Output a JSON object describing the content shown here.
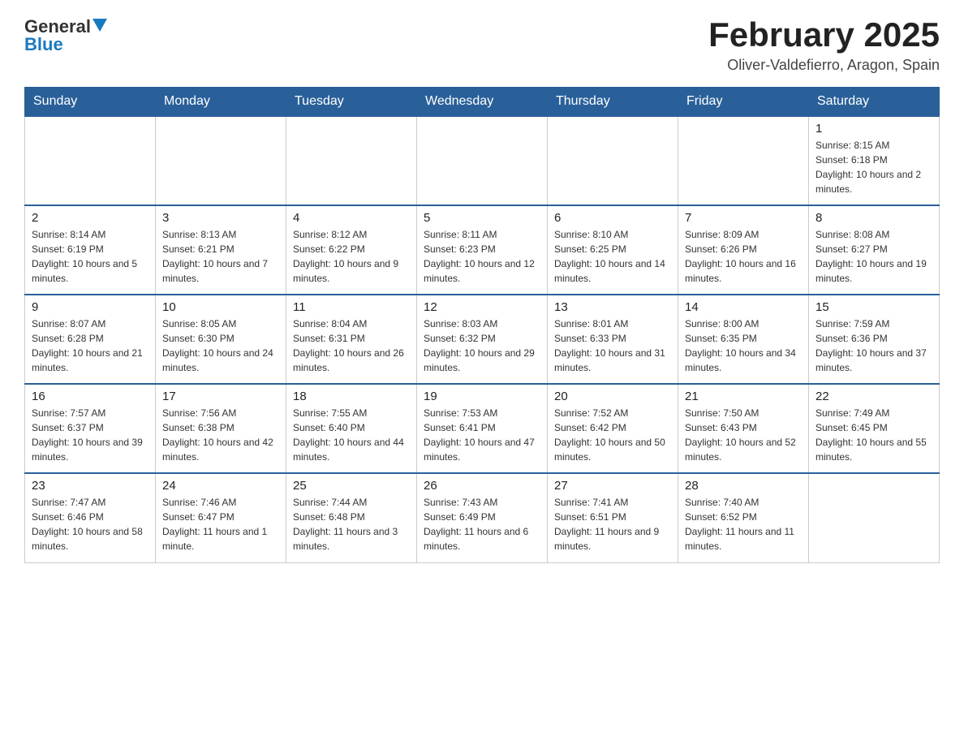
{
  "header": {
    "logo_general": "General",
    "logo_blue": "Blue",
    "month_year": "February 2025",
    "location": "Oliver-Valdefierro, Aragon, Spain"
  },
  "weekdays": [
    "Sunday",
    "Monday",
    "Tuesday",
    "Wednesday",
    "Thursday",
    "Friday",
    "Saturday"
  ],
  "weeks": [
    [
      {
        "day": "",
        "info": ""
      },
      {
        "day": "",
        "info": ""
      },
      {
        "day": "",
        "info": ""
      },
      {
        "day": "",
        "info": ""
      },
      {
        "day": "",
        "info": ""
      },
      {
        "day": "",
        "info": ""
      },
      {
        "day": "1",
        "info": "Sunrise: 8:15 AM\nSunset: 6:18 PM\nDaylight: 10 hours and 2 minutes."
      }
    ],
    [
      {
        "day": "2",
        "info": "Sunrise: 8:14 AM\nSunset: 6:19 PM\nDaylight: 10 hours and 5 minutes."
      },
      {
        "day": "3",
        "info": "Sunrise: 8:13 AM\nSunset: 6:21 PM\nDaylight: 10 hours and 7 minutes."
      },
      {
        "day": "4",
        "info": "Sunrise: 8:12 AM\nSunset: 6:22 PM\nDaylight: 10 hours and 9 minutes."
      },
      {
        "day": "5",
        "info": "Sunrise: 8:11 AM\nSunset: 6:23 PM\nDaylight: 10 hours and 12 minutes."
      },
      {
        "day": "6",
        "info": "Sunrise: 8:10 AM\nSunset: 6:25 PM\nDaylight: 10 hours and 14 minutes."
      },
      {
        "day": "7",
        "info": "Sunrise: 8:09 AM\nSunset: 6:26 PM\nDaylight: 10 hours and 16 minutes."
      },
      {
        "day": "8",
        "info": "Sunrise: 8:08 AM\nSunset: 6:27 PM\nDaylight: 10 hours and 19 minutes."
      }
    ],
    [
      {
        "day": "9",
        "info": "Sunrise: 8:07 AM\nSunset: 6:28 PM\nDaylight: 10 hours and 21 minutes."
      },
      {
        "day": "10",
        "info": "Sunrise: 8:05 AM\nSunset: 6:30 PM\nDaylight: 10 hours and 24 minutes."
      },
      {
        "day": "11",
        "info": "Sunrise: 8:04 AM\nSunset: 6:31 PM\nDaylight: 10 hours and 26 minutes."
      },
      {
        "day": "12",
        "info": "Sunrise: 8:03 AM\nSunset: 6:32 PM\nDaylight: 10 hours and 29 minutes."
      },
      {
        "day": "13",
        "info": "Sunrise: 8:01 AM\nSunset: 6:33 PM\nDaylight: 10 hours and 31 minutes."
      },
      {
        "day": "14",
        "info": "Sunrise: 8:00 AM\nSunset: 6:35 PM\nDaylight: 10 hours and 34 minutes."
      },
      {
        "day": "15",
        "info": "Sunrise: 7:59 AM\nSunset: 6:36 PM\nDaylight: 10 hours and 37 minutes."
      }
    ],
    [
      {
        "day": "16",
        "info": "Sunrise: 7:57 AM\nSunset: 6:37 PM\nDaylight: 10 hours and 39 minutes."
      },
      {
        "day": "17",
        "info": "Sunrise: 7:56 AM\nSunset: 6:38 PM\nDaylight: 10 hours and 42 minutes."
      },
      {
        "day": "18",
        "info": "Sunrise: 7:55 AM\nSunset: 6:40 PM\nDaylight: 10 hours and 44 minutes."
      },
      {
        "day": "19",
        "info": "Sunrise: 7:53 AM\nSunset: 6:41 PM\nDaylight: 10 hours and 47 minutes."
      },
      {
        "day": "20",
        "info": "Sunrise: 7:52 AM\nSunset: 6:42 PM\nDaylight: 10 hours and 50 minutes."
      },
      {
        "day": "21",
        "info": "Sunrise: 7:50 AM\nSunset: 6:43 PM\nDaylight: 10 hours and 52 minutes."
      },
      {
        "day": "22",
        "info": "Sunrise: 7:49 AM\nSunset: 6:45 PM\nDaylight: 10 hours and 55 minutes."
      }
    ],
    [
      {
        "day": "23",
        "info": "Sunrise: 7:47 AM\nSunset: 6:46 PM\nDaylight: 10 hours and 58 minutes."
      },
      {
        "day": "24",
        "info": "Sunrise: 7:46 AM\nSunset: 6:47 PM\nDaylight: 11 hours and 1 minute."
      },
      {
        "day": "25",
        "info": "Sunrise: 7:44 AM\nSunset: 6:48 PM\nDaylight: 11 hours and 3 minutes."
      },
      {
        "day": "26",
        "info": "Sunrise: 7:43 AM\nSunset: 6:49 PM\nDaylight: 11 hours and 6 minutes."
      },
      {
        "day": "27",
        "info": "Sunrise: 7:41 AM\nSunset: 6:51 PM\nDaylight: 11 hours and 9 minutes."
      },
      {
        "day": "28",
        "info": "Sunrise: 7:40 AM\nSunset: 6:52 PM\nDaylight: 11 hours and 11 minutes."
      },
      {
        "day": "",
        "info": ""
      }
    ]
  ]
}
